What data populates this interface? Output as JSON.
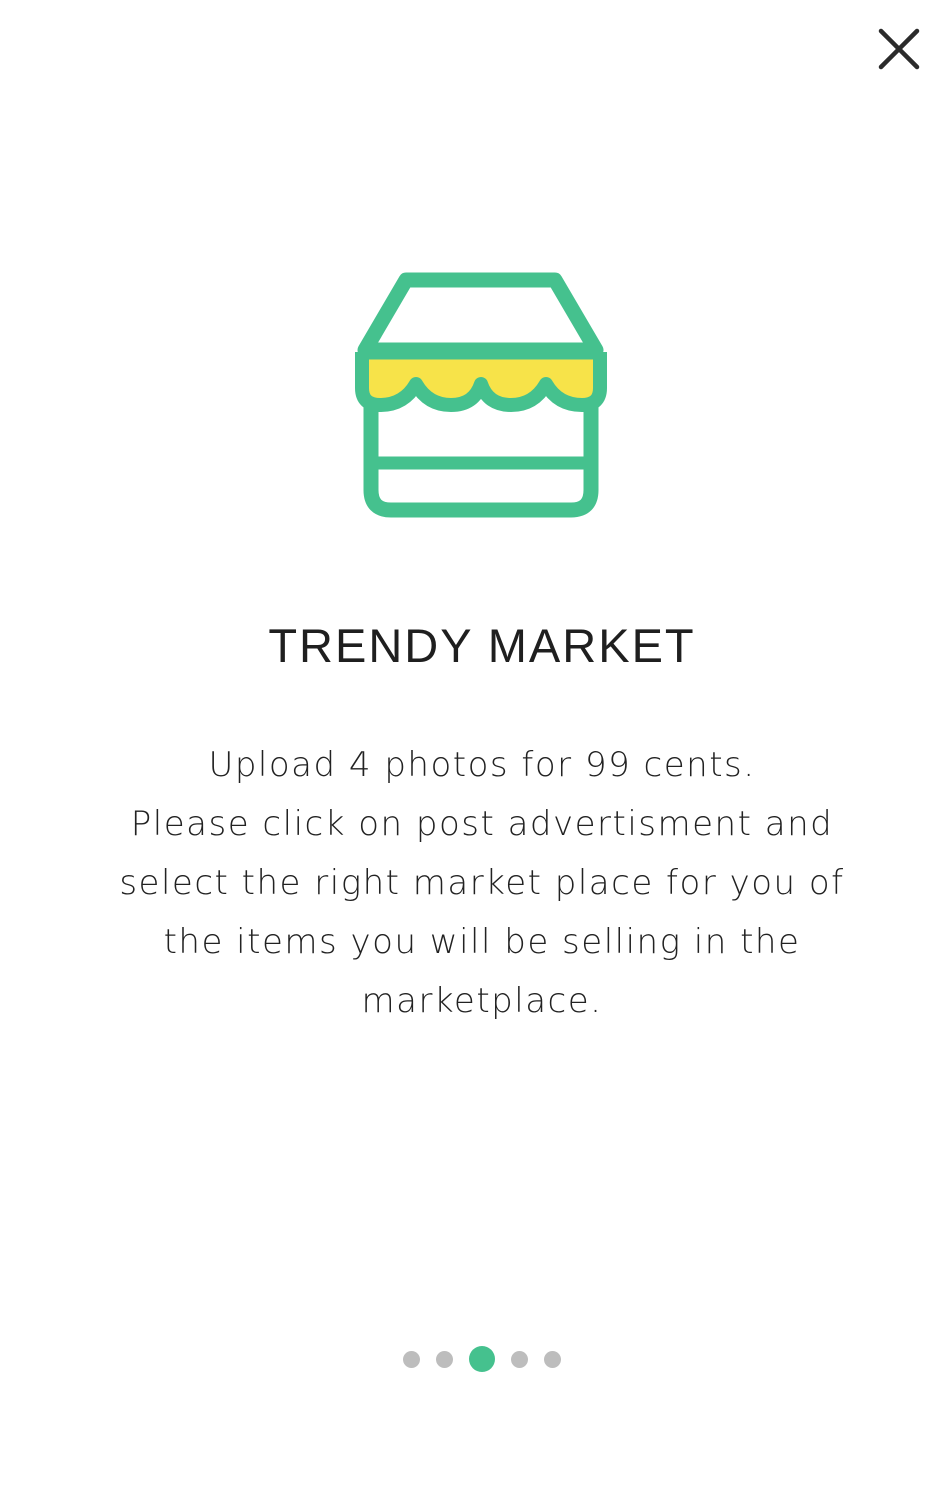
{
  "app": {
    "accent_color": "#45c18e",
    "awning_color": "#f7e349",
    "dot_color": "#bdbdbd"
  },
  "header": {
    "close_icon": "close-icon"
  },
  "hero": {
    "icon": "store-icon"
  },
  "content": {
    "title": "TRENDY MARKET",
    "body_lines": [
      "Upload 4 photos for 99 cents.",
      "Please click on post advertisment and",
      "select the right market place for you of",
      "the items you will be selling in the",
      "marketplace."
    ]
  },
  "pager": {
    "total_pages": 5,
    "current_page": 3
  }
}
